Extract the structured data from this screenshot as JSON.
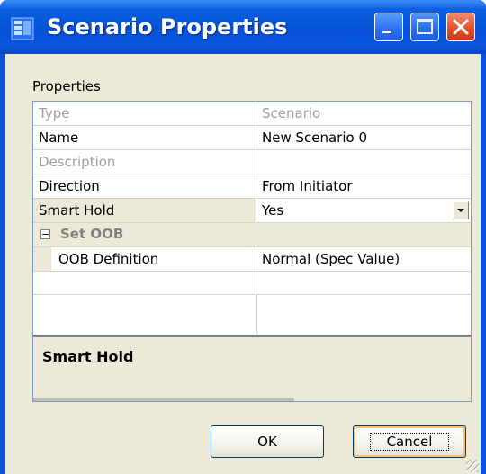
{
  "window": {
    "title": "Scenario Properties",
    "icon": "app-icon",
    "controls": [
      "minimize-icon",
      "maximize-icon",
      "close-icon"
    ]
  },
  "properties": {
    "group_label": "Properties",
    "rows": [
      {
        "name": "Type",
        "value": "Scenario",
        "readonly": true
      },
      {
        "name": "Name",
        "value": "New Scenario 0",
        "readonly": false
      },
      {
        "name": "Description",
        "value": "",
        "readonly": true
      },
      {
        "name": "Direction",
        "value": "From Initiator",
        "readonly": false
      },
      {
        "name": "Smart Hold",
        "value": "Yes",
        "readonly": false,
        "dropdown": true
      }
    ],
    "category": {
      "toggle": "⊟",
      "label": "Set OOB"
    },
    "sub_rows": [
      {
        "name": "OOB Definition",
        "value": "Normal (Spec Value)"
      }
    ]
  },
  "description_panel": {
    "title": "Smart Hold"
  },
  "buttons": {
    "ok": "OK",
    "cancel": "Cancel"
  },
  "colors": {
    "titlebar": "#0a52d8",
    "client": "#ece9d8",
    "close": "#e2502a"
  }
}
